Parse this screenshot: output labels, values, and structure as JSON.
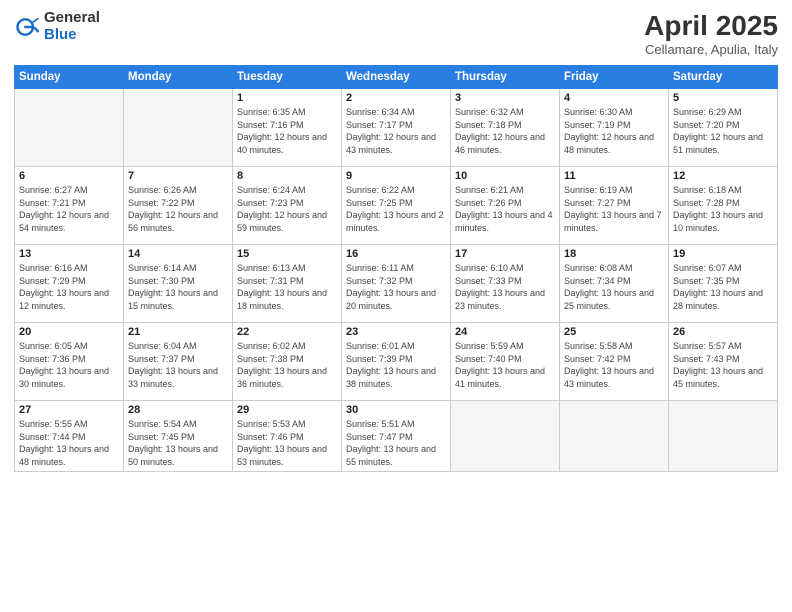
{
  "logo": {
    "general": "General",
    "blue": "Blue"
  },
  "title": "April 2025",
  "subtitle": "Cellamare, Apulia, Italy",
  "weekdays": [
    "Sunday",
    "Monday",
    "Tuesday",
    "Wednesday",
    "Thursday",
    "Friday",
    "Saturday"
  ],
  "weeks": [
    [
      {
        "day": "",
        "info": ""
      },
      {
        "day": "",
        "info": ""
      },
      {
        "day": "1",
        "info": "Sunrise: 6:35 AM\nSunset: 7:16 PM\nDaylight: 12 hours and 40 minutes."
      },
      {
        "day": "2",
        "info": "Sunrise: 6:34 AM\nSunset: 7:17 PM\nDaylight: 12 hours and 43 minutes."
      },
      {
        "day": "3",
        "info": "Sunrise: 6:32 AM\nSunset: 7:18 PM\nDaylight: 12 hours and 46 minutes."
      },
      {
        "day": "4",
        "info": "Sunrise: 6:30 AM\nSunset: 7:19 PM\nDaylight: 12 hours and 48 minutes."
      },
      {
        "day": "5",
        "info": "Sunrise: 6:29 AM\nSunset: 7:20 PM\nDaylight: 12 hours and 51 minutes."
      }
    ],
    [
      {
        "day": "6",
        "info": "Sunrise: 6:27 AM\nSunset: 7:21 PM\nDaylight: 12 hours and 54 minutes."
      },
      {
        "day": "7",
        "info": "Sunrise: 6:26 AM\nSunset: 7:22 PM\nDaylight: 12 hours and 56 minutes."
      },
      {
        "day": "8",
        "info": "Sunrise: 6:24 AM\nSunset: 7:23 PM\nDaylight: 12 hours and 59 minutes."
      },
      {
        "day": "9",
        "info": "Sunrise: 6:22 AM\nSunset: 7:25 PM\nDaylight: 13 hours and 2 minutes."
      },
      {
        "day": "10",
        "info": "Sunrise: 6:21 AM\nSunset: 7:26 PM\nDaylight: 13 hours and 4 minutes."
      },
      {
        "day": "11",
        "info": "Sunrise: 6:19 AM\nSunset: 7:27 PM\nDaylight: 13 hours and 7 minutes."
      },
      {
        "day": "12",
        "info": "Sunrise: 6:18 AM\nSunset: 7:28 PM\nDaylight: 13 hours and 10 minutes."
      }
    ],
    [
      {
        "day": "13",
        "info": "Sunrise: 6:16 AM\nSunset: 7:29 PM\nDaylight: 13 hours and 12 minutes."
      },
      {
        "day": "14",
        "info": "Sunrise: 6:14 AM\nSunset: 7:30 PM\nDaylight: 13 hours and 15 minutes."
      },
      {
        "day": "15",
        "info": "Sunrise: 6:13 AM\nSunset: 7:31 PM\nDaylight: 13 hours and 18 minutes."
      },
      {
        "day": "16",
        "info": "Sunrise: 6:11 AM\nSunset: 7:32 PM\nDaylight: 13 hours and 20 minutes."
      },
      {
        "day": "17",
        "info": "Sunrise: 6:10 AM\nSunset: 7:33 PM\nDaylight: 13 hours and 23 minutes."
      },
      {
        "day": "18",
        "info": "Sunrise: 6:08 AM\nSunset: 7:34 PM\nDaylight: 13 hours and 25 minutes."
      },
      {
        "day": "19",
        "info": "Sunrise: 6:07 AM\nSunset: 7:35 PM\nDaylight: 13 hours and 28 minutes."
      }
    ],
    [
      {
        "day": "20",
        "info": "Sunrise: 6:05 AM\nSunset: 7:36 PM\nDaylight: 13 hours and 30 minutes."
      },
      {
        "day": "21",
        "info": "Sunrise: 6:04 AM\nSunset: 7:37 PM\nDaylight: 13 hours and 33 minutes."
      },
      {
        "day": "22",
        "info": "Sunrise: 6:02 AM\nSunset: 7:38 PM\nDaylight: 13 hours and 36 minutes."
      },
      {
        "day": "23",
        "info": "Sunrise: 6:01 AM\nSunset: 7:39 PM\nDaylight: 13 hours and 38 minutes."
      },
      {
        "day": "24",
        "info": "Sunrise: 5:59 AM\nSunset: 7:40 PM\nDaylight: 13 hours and 41 minutes."
      },
      {
        "day": "25",
        "info": "Sunrise: 5:58 AM\nSunset: 7:42 PM\nDaylight: 13 hours and 43 minutes."
      },
      {
        "day": "26",
        "info": "Sunrise: 5:57 AM\nSunset: 7:43 PM\nDaylight: 13 hours and 45 minutes."
      }
    ],
    [
      {
        "day": "27",
        "info": "Sunrise: 5:55 AM\nSunset: 7:44 PM\nDaylight: 13 hours and 48 minutes."
      },
      {
        "day": "28",
        "info": "Sunrise: 5:54 AM\nSunset: 7:45 PM\nDaylight: 13 hours and 50 minutes."
      },
      {
        "day": "29",
        "info": "Sunrise: 5:53 AM\nSunset: 7:46 PM\nDaylight: 13 hours and 53 minutes."
      },
      {
        "day": "30",
        "info": "Sunrise: 5:51 AM\nSunset: 7:47 PM\nDaylight: 13 hours and 55 minutes."
      },
      {
        "day": "",
        "info": ""
      },
      {
        "day": "",
        "info": ""
      },
      {
        "day": "",
        "info": ""
      }
    ]
  ]
}
